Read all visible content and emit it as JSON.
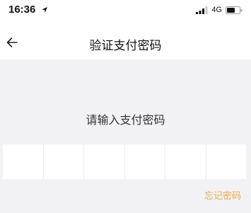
{
  "status_bar": {
    "time": "16:36",
    "network": "4G",
    "icons": [
      "location-arrow-icon",
      "signal-icon",
      "battery-icon"
    ]
  },
  "nav": {
    "title": "验证支付密码",
    "back_icon": "arrow-left-icon"
  },
  "main": {
    "prompt": "请输入支付密码",
    "pin_length": 6,
    "pin_digits": [
      "",
      "",
      "",
      "",
      "",
      ""
    ],
    "forgot_label": "忘记密码"
  },
  "colors": {
    "background": "#f2f2f4",
    "surface": "#ffffff",
    "accent": "#e8a949",
    "text": "#111111"
  }
}
